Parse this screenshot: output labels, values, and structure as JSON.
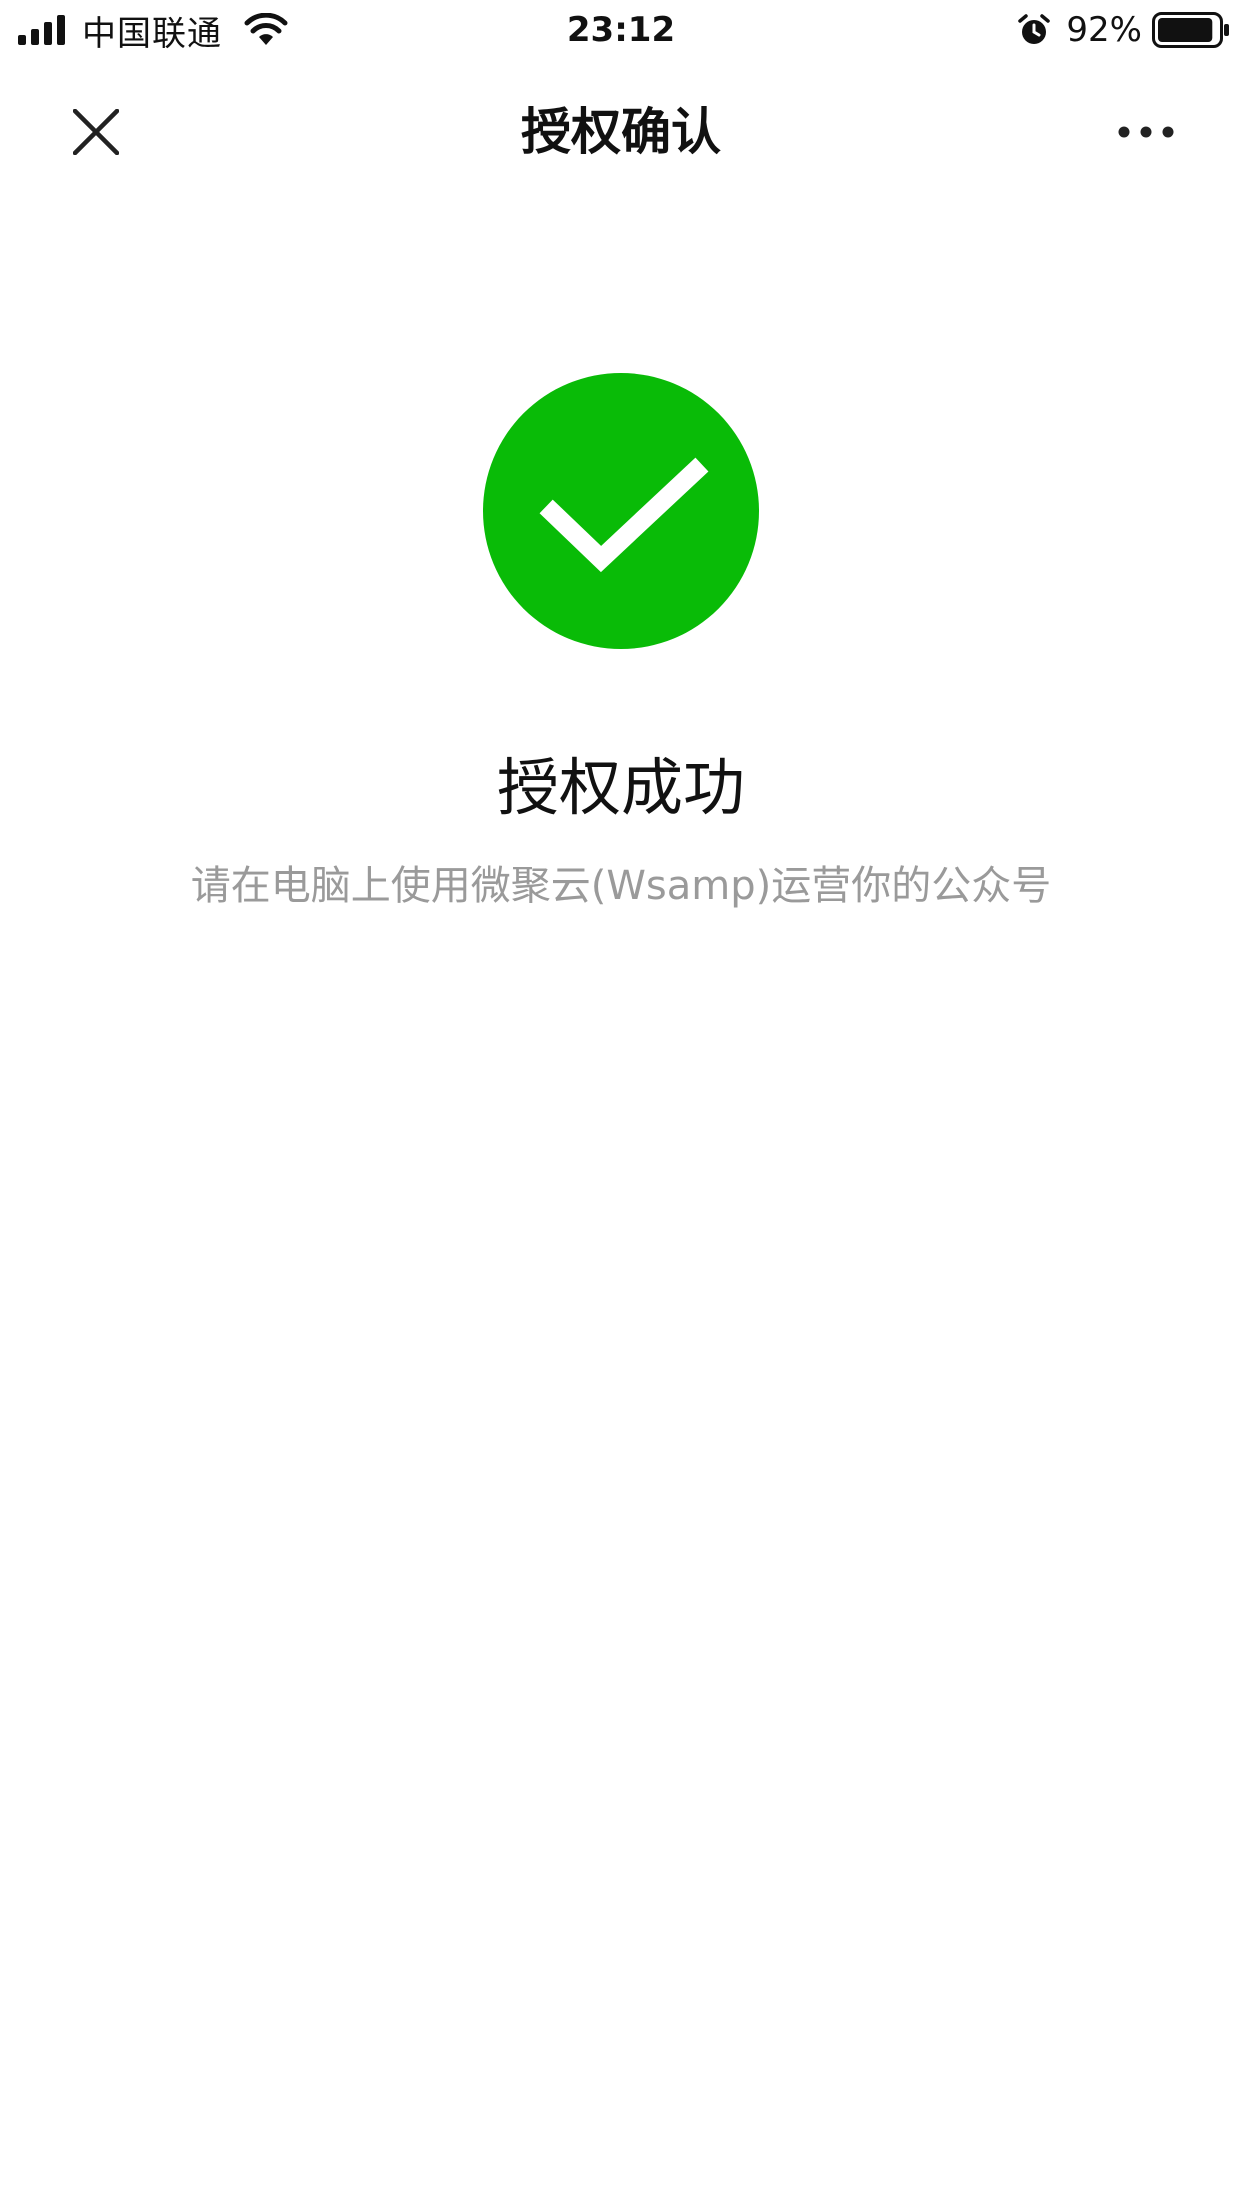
{
  "status_bar": {
    "carrier": "中国联通",
    "time": "23:12",
    "battery_percent": "92%",
    "battery_level": 0.92,
    "icons": [
      "signal-icon",
      "wifi-icon",
      "alarm-icon",
      "battery-icon"
    ]
  },
  "nav": {
    "title": "授权确认",
    "close_icon": "close-icon",
    "more_icon": "more-dots-icon"
  },
  "result": {
    "icon": "success-check-icon",
    "title": "授权成功",
    "description": "请在电脑上使用微聚云(Wsamp)运营你的公众号"
  },
  "colors": {
    "success_green": "#09bb07",
    "text_primary": "#111111",
    "text_secondary": "#9a9a9a",
    "background": "#ffffff"
  }
}
